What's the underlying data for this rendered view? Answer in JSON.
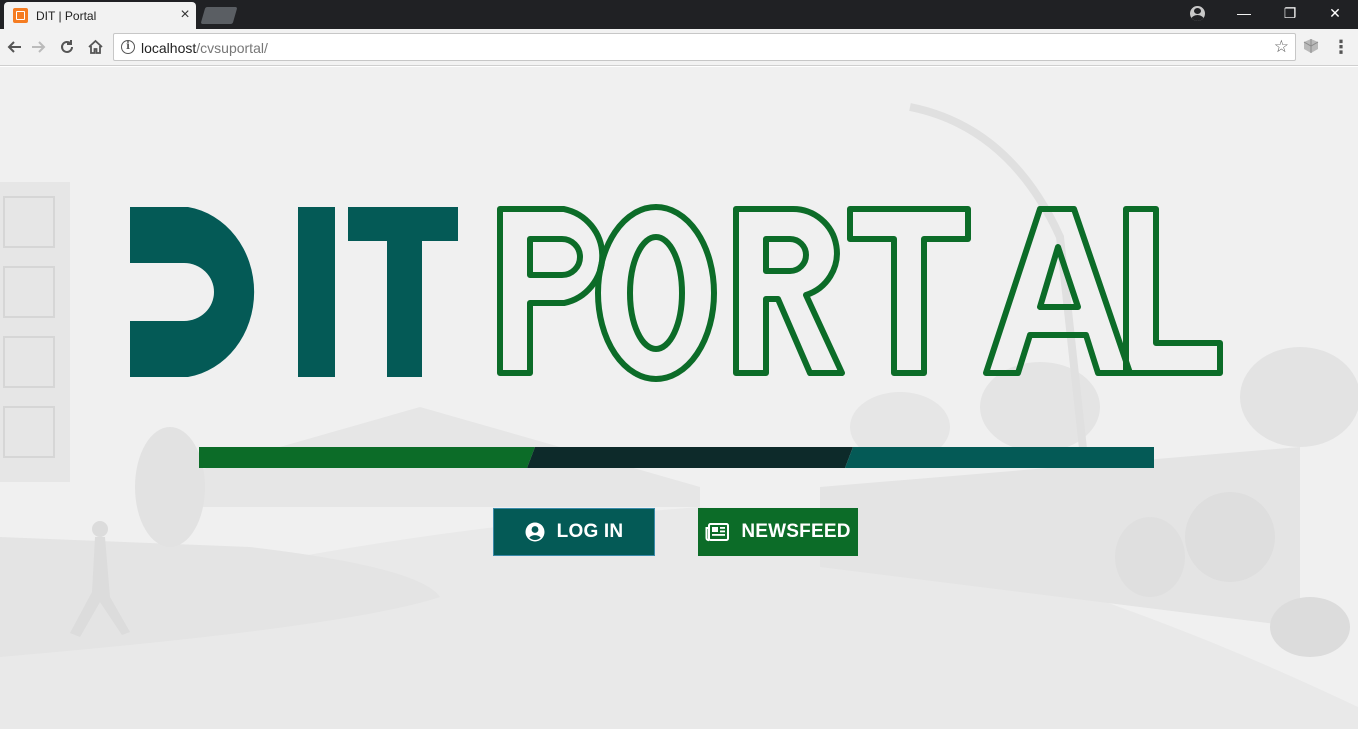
{
  "browser": {
    "tab_title": "DIT | Portal",
    "tab_close": "×",
    "url_host": "localhost",
    "url_path": "/cvsuportal/",
    "window_controls": [
      "—",
      "❐",
      "✕"
    ]
  },
  "page": {
    "logo_text": "DIT PORTAL",
    "buttons": {
      "login": "LOG IN",
      "newsfeed": "NEWSFEED"
    }
  },
  "colors": {
    "dit_teal": "#045a56",
    "portal_green": "#0c6c28",
    "bar_dark": "#0d2a2a",
    "login_border": "#3a8aa8"
  },
  "icons": [
    "user-circle-icon",
    "newspaper-icon",
    "back-arrow-icon",
    "forward-arrow-icon",
    "reload-icon",
    "home-icon",
    "info-icon",
    "star-icon",
    "menu-icon"
  ]
}
